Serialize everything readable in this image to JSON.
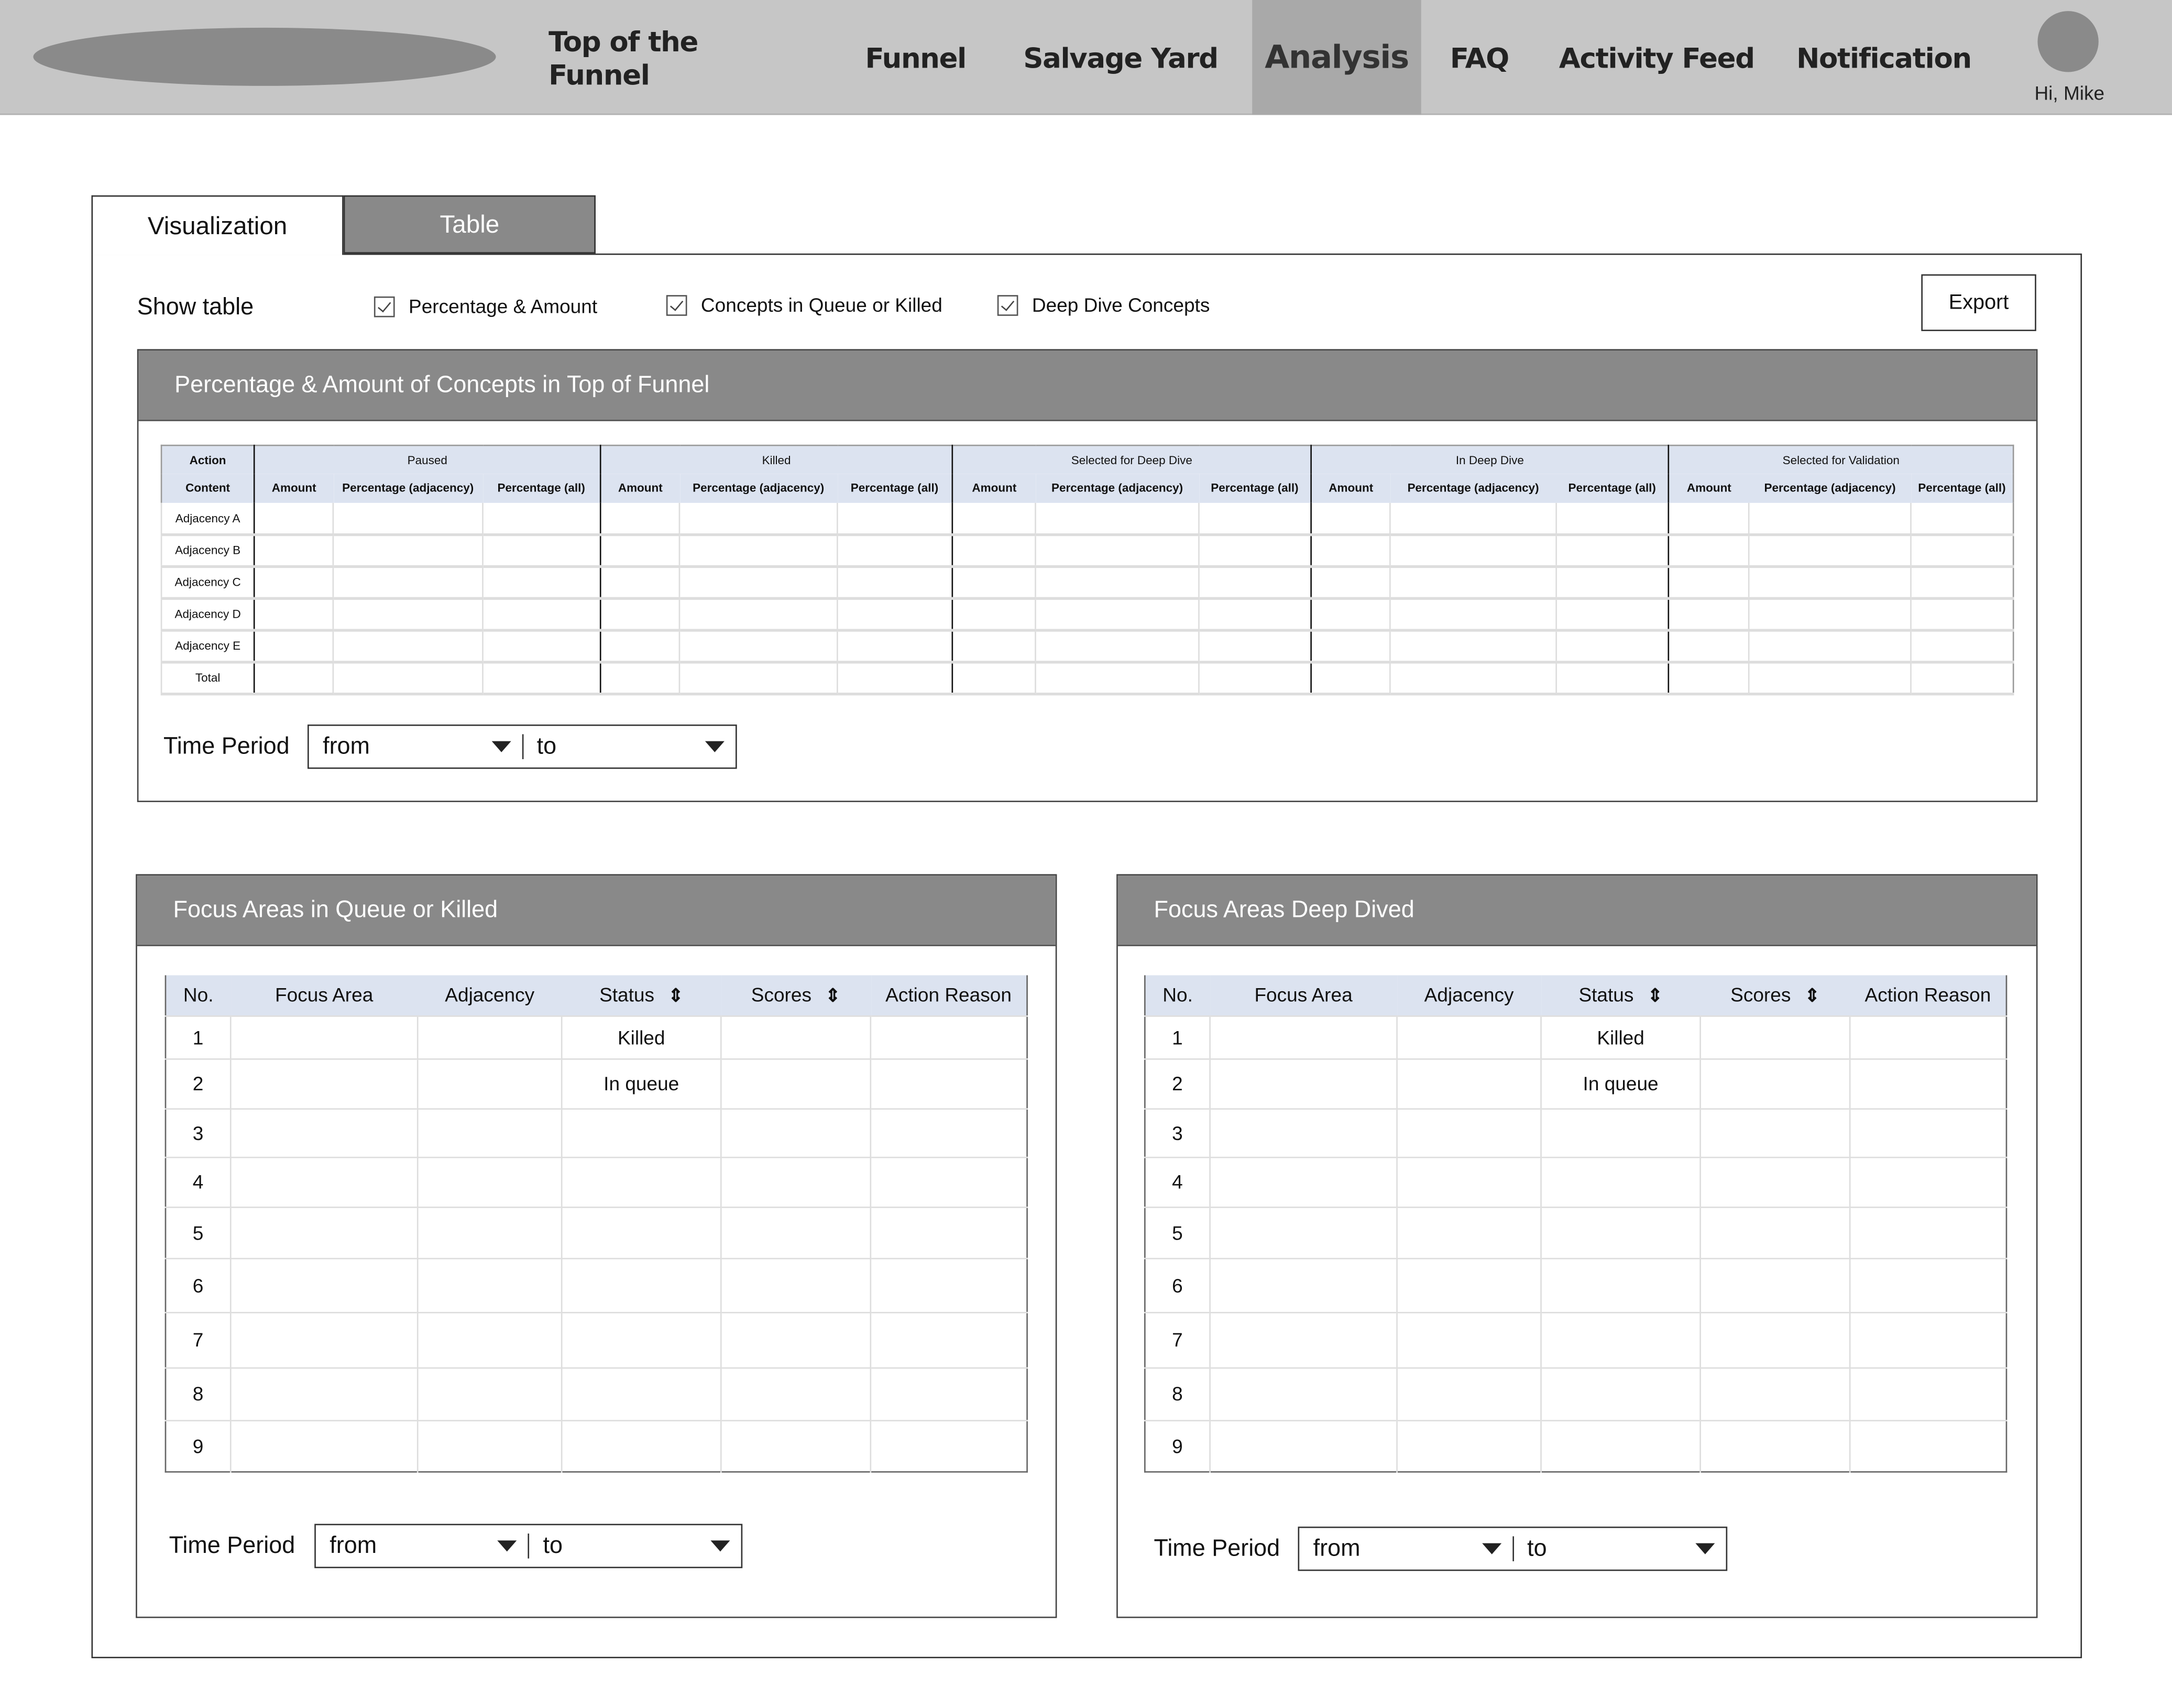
{
  "nav": {
    "items": [
      {
        "label": "Top of the Funnel",
        "active": false
      },
      {
        "label": "Funnel",
        "active": false
      },
      {
        "label": "Salvage Yard",
        "active": false
      },
      {
        "label": "Analysis",
        "active": true
      },
      {
        "label": "FAQ",
        "active": false
      },
      {
        "label": "Activity Feed",
        "active": false
      },
      {
        "label": "Notification",
        "active": false
      }
    ],
    "greeting": "Hi, Mike"
  },
  "tabs": [
    {
      "label": "Visualization",
      "active": true
    },
    {
      "label": "Table",
      "active": false
    }
  ],
  "toolbar": {
    "show_table": "Show table",
    "options": [
      {
        "label": "Percentage & Amount",
        "checked": true
      },
      {
        "label": "Concepts in Queue or Killed",
        "checked": true
      },
      {
        "label": "Deep Dive Concepts",
        "checked": true
      }
    ],
    "export": "Export"
  },
  "funnel_panel": {
    "title": "Percentage & Amount of Concepts in Top of Funnel",
    "corner_top": "Action",
    "corner_bottom": "Content",
    "groups": [
      "Paused",
      "Killed",
      "Selected for Deep Dive",
      "In Deep Dive",
      "Selected for Validation"
    ],
    "subcolumns": [
      "Amount",
      "Percentage (adjacency)",
      "Percentage (all)"
    ],
    "rows": [
      "Adjacency A",
      "Adjacency B",
      "Adjacency C",
      "Adjacency D",
      "Adjacency E",
      "Total"
    ],
    "time_period": {
      "label": "Time Period",
      "from": "from",
      "to": "to"
    }
  },
  "queue_panel": {
    "title": "Focus Areas in Queue or Killed",
    "columns": [
      "No.",
      "Focus Area",
      "Adjacency",
      "Status",
      "Scores",
      "Action Reason"
    ],
    "rows": [
      [
        "1",
        "",
        "",
        "Killed",
        "",
        ""
      ],
      [
        "2",
        "",
        "",
        "In queue",
        "",
        ""
      ],
      [
        "3",
        "",
        "",
        "",
        "",
        ""
      ],
      [
        "4",
        "",
        "",
        "",
        "",
        ""
      ],
      [
        "5",
        "",
        "",
        "",
        "",
        ""
      ],
      [
        "6",
        "",
        "",
        "",
        "",
        ""
      ],
      [
        "7",
        "",
        "",
        "",
        "",
        ""
      ],
      [
        "8",
        "",
        "",
        "",
        "",
        ""
      ],
      [
        "9",
        "",
        "",
        "",
        "",
        ""
      ]
    ],
    "time_period": {
      "label": "Time Period",
      "from": "from",
      "to": "to"
    }
  },
  "deepdive_panel": {
    "title": "Focus Areas Deep Dived",
    "columns": [
      "No.",
      "Focus Area",
      "Adjacency",
      "Status",
      "Scores",
      "Action Reason"
    ],
    "rows": [
      [
        "1",
        "",
        "",
        "Killed",
        "",
        ""
      ],
      [
        "2",
        "",
        "",
        "In queue",
        "",
        ""
      ],
      [
        "3",
        "",
        "",
        "",
        "",
        ""
      ],
      [
        "4",
        "",
        "",
        "",
        "",
        ""
      ],
      [
        "5",
        "",
        "",
        "",
        "",
        ""
      ],
      [
        "6",
        "",
        "",
        "",
        "",
        ""
      ],
      [
        "7",
        "",
        "",
        "",
        "",
        ""
      ],
      [
        "8",
        "",
        "",
        "",
        "",
        ""
      ],
      [
        "9",
        "",
        "",
        "",
        "",
        ""
      ]
    ],
    "time_period": {
      "label": "Time Period",
      "from": "from",
      "to": "to"
    }
  },
  "colors": {
    "nav_bg": "#c6c6c6",
    "active_nav": "#a9a9a9",
    "panel_header": "#898989",
    "table_header": "#dce3f0"
  }
}
